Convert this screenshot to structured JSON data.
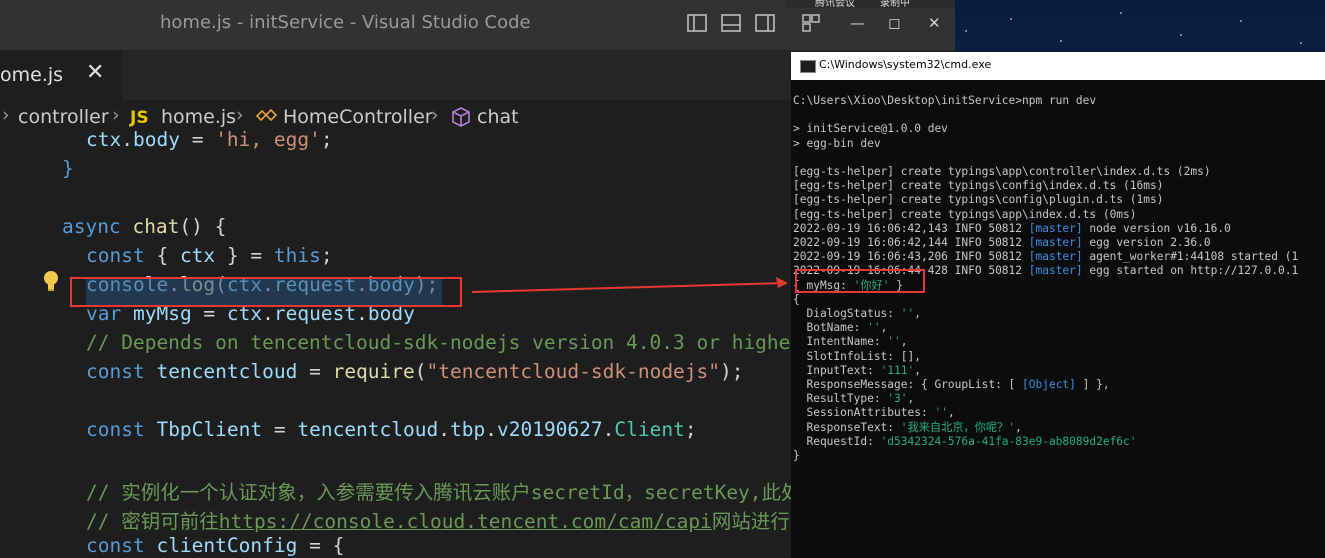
{
  "vscode": {
    "window_title": "home.js - initService - Visual Studio Code",
    "tab": {
      "label": "ome.js",
      "close": "✕"
    },
    "breadcrumb": {
      "items": [
        "controller",
        "home.js",
        "HomeController",
        "chat"
      ],
      "js_badge": "JS",
      "separator": "›"
    },
    "code_lines": [
      {
        "parts": [
          [
            "var",
            "ctx"
          ],
          [
            "",
            "."
          ],
          [
            "var",
            "body"
          ],
          [
            "",
            " = "
          ],
          [
            "str",
            "'hi, egg'"
          ],
          [
            "",
            ";"
          ]
        ]
      },
      {
        "parts": [
          [
            "kw",
            "}"
          ]
        ]
      },
      {
        "parts": []
      },
      {
        "parts": [
          [
            "kw",
            "async"
          ],
          [
            "",
            " "
          ],
          [
            "fn",
            "chat"
          ],
          [
            "",
            "() {"
          ]
        ]
      },
      {
        "parts": [
          [
            "kw",
            "const"
          ],
          [
            "",
            " { "
          ],
          [
            "var",
            "ctx"
          ],
          [
            "",
            " } = "
          ],
          [
            "kw",
            "this"
          ],
          [
            "",
            ";"
          ]
        ]
      },
      {
        "parts": [
          [
            "var",
            "console"
          ],
          [
            "",
            "."
          ],
          [
            "fn",
            "log"
          ],
          [
            "",
            "("
          ],
          [
            "var",
            "ctx"
          ],
          [
            "",
            "."
          ],
          [
            "var",
            "request"
          ],
          [
            "",
            "."
          ],
          [
            "var",
            "body"
          ],
          [
            "",
            ");"
          ]
        ]
      },
      {
        "parts": [
          [
            "kw",
            "var"
          ],
          [
            "",
            " "
          ],
          [
            "var",
            "myMsg"
          ],
          [
            "",
            " = "
          ],
          [
            "var",
            "ctx"
          ],
          [
            "",
            "."
          ],
          [
            "var",
            "request"
          ],
          [
            "",
            "."
          ],
          [
            "var",
            "body"
          ]
        ]
      },
      {
        "parts": [
          [
            "cmt",
            "// Depends on tencentcloud-sdk-nodejs version 4.0.3 or highe"
          ]
        ]
      },
      {
        "parts": [
          [
            "kw",
            "const"
          ],
          [
            "",
            " "
          ],
          [
            "var",
            "tencentcloud"
          ],
          [
            "",
            " = "
          ],
          [
            "fn",
            "require"
          ],
          [
            "",
            "("
          ],
          [
            "str",
            "\"tencentcloud-sdk-nodejs\""
          ],
          [
            "",
            ");"
          ]
        ]
      },
      {
        "parts": []
      },
      {
        "parts": [
          [
            "kw",
            "const"
          ],
          [
            "",
            " "
          ],
          [
            "var",
            "TbpClient"
          ],
          [
            "",
            " = "
          ],
          [
            "var",
            "tencentcloud"
          ],
          [
            "",
            "."
          ],
          [
            "var",
            "tbp"
          ],
          [
            "",
            "."
          ],
          [
            "var",
            "v20190627"
          ],
          [
            "",
            "."
          ],
          [
            "cls",
            "Client"
          ],
          [
            "",
            ";"
          ]
        ]
      },
      {
        "parts": []
      },
      {
        "parts": [
          [
            "cmt",
            "// 实例化一个认证对象，入参需要传入腾讯云账户secretId，secretKey,此处还"
          ]
        ]
      },
      {
        "parts": [
          [
            "cmt",
            "// 密钥可前往"
          ],
          [
            "link",
            "https://console.cloud.tencent.com/cam/capi"
          ],
          [
            "cmt",
            "网站进行获取"
          ]
        ]
      },
      {
        "parts": [
          [
            "kw",
            "const"
          ],
          [
            "",
            " "
          ],
          [
            "var",
            "clientConfig"
          ],
          [
            "",
            " = {"
          ]
        ]
      }
    ]
  },
  "meeting_bar": {
    "left": "腾讯会议",
    "right": "录制中"
  },
  "cmd": {
    "title": "C:\\Windows\\system32\\cmd.exe",
    "lines": [
      {
        "parts": [
          [
            "",
            "C:\\Users\\Xioo\\Desktop\\initService>npm run dev"
          ]
        ]
      },
      {
        "parts": []
      },
      {
        "parts": [
          [
            "",
            "> initService@1.0.0 dev"
          ]
        ]
      },
      {
        "parts": [
          [
            "",
            "> egg-bin dev"
          ]
        ]
      },
      {
        "parts": []
      },
      {
        "parts": [
          [
            "",
            "[egg-ts-helper] create typings\\app\\controller\\index.d.ts (2ms)"
          ]
        ]
      },
      {
        "parts": [
          [
            "",
            "[egg-ts-helper] create typings\\config\\index.d.ts (16ms)"
          ]
        ]
      },
      {
        "parts": [
          [
            "",
            "[egg-ts-helper] create typings\\config\\plugin.d.ts (1ms)"
          ]
        ]
      },
      {
        "parts": [
          [
            "",
            "[egg-ts-helper] create typings\\app\\index.d.ts (0ms)"
          ]
        ]
      },
      {
        "parts": [
          [
            "",
            "2022-09-19 16:06:42,143 INFO 50812 "
          ],
          [
            "cyan",
            "[master]"
          ],
          [
            "",
            " node version v16.16.0"
          ]
        ]
      },
      {
        "parts": [
          [
            "",
            "2022-09-19 16:06:42,144 INFO 50812 "
          ],
          [
            "cyan",
            "[master]"
          ],
          [
            "",
            " egg version 2.36.0"
          ]
        ]
      },
      {
        "parts": [
          [
            "",
            "2022-09-19 16:06:43,206 INFO 50812 "
          ],
          [
            "cyan",
            "[master]"
          ],
          [
            "",
            " agent_worker#1:44108 started (1"
          ]
        ]
      },
      {
        "parts": [
          [
            "",
            "2022-09-19 16:06:44,428 INFO 50812 "
          ],
          [
            "cyan",
            "[master]"
          ],
          [
            "",
            " egg started on http://127.0.0.1"
          ]
        ]
      },
      {
        "parts": [
          [
            "",
            "{ myMsg: "
          ],
          [
            "green",
            "'你好'"
          ],
          [
            "",
            " }"
          ]
        ]
      },
      {
        "parts": [
          [
            "",
            "{"
          ]
        ]
      },
      {
        "parts": [
          [
            "",
            "  DialogStatus: "
          ],
          [
            "green",
            "''"
          ],
          [
            "",
            ","
          ]
        ]
      },
      {
        "parts": [
          [
            "",
            "  BotName: "
          ],
          [
            "green",
            "''"
          ],
          [
            "",
            ","
          ]
        ]
      },
      {
        "parts": [
          [
            "",
            "  IntentName: "
          ],
          [
            "green",
            "''"
          ],
          [
            "",
            ","
          ]
        ]
      },
      {
        "parts": [
          [
            "",
            "  SlotInfoList: [],"
          ]
        ]
      },
      {
        "parts": [
          [
            "",
            "  InputText: "
          ],
          [
            "green",
            "'111'"
          ],
          [
            "",
            ","
          ]
        ]
      },
      {
        "parts": [
          [
            "",
            "  ResponseMessage: { GroupList: [ "
          ],
          [
            "cyan",
            "[Object]"
          ],
          [
            "",
            " ] },"
          ]
        ]
      },
      {
        "parts": [
          [
            "",
            "  ResultType: "
          ],
          [
            "green",
            "'3'"
          ],
          [
            "",
            ","
          ]
        ]
      },
      {
        "parts": [
          [
            "",
            "  SessionAttributes: "
          ],
          [
            "green",
            "''"
          ],
          [
            "",
            ","
          ]
        ]
      },
      {
        "parts": [
          [
            "",
            "  ResponseText: "
          ],
          [
            "green",
            "'我来自北京，你呢？'"
          ],
          [
            "",
            ","
          ]
        ]
      },
      {
        "parts": [
          [
            "",
            "  RequestId: "
          ],
          [
            "green",
            "'d5342324-576a-41fa-83e9-ab8089d2ef6c'"
          ]
        ]
      },
      {
        "parts": [
          [
            "",
            "}"
          ]
        ]
      }
    ]
  },
  "colors": {
    "highlight": "#e53935",
    "selection": "#264f78"
  },
  "icons": [
    "layout-sidebar-icon",
    "layout-panel-icon",
    "layout-split-icon",
    "customize-layout-icon",
    "lightbulb-icon",
    "class-icon",
    "method-cube-icon",
    "cmd-icon"
  ]
}
